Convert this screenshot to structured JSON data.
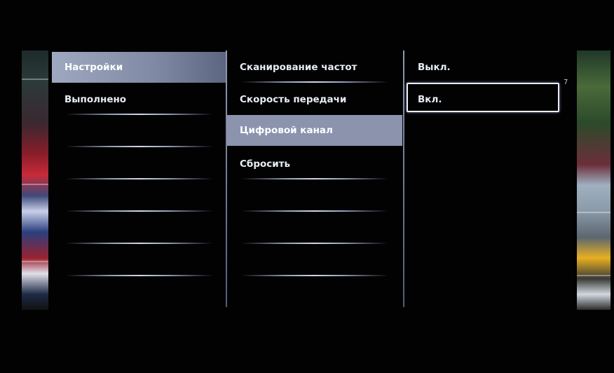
{
  "menu": {
    "column1": {
      "items": [
        "Настройки",
        "Выполнено"
      ],
      "selected_index": 0
    },
    "column2": {
      "items": [
        "Сканирование частот",
        "Скорость передачи",
        "Цифровой канал",
        "Сбросить"
      ],
      "selected_index": 2
    },
    "column3": {
      "items": [
        "Выкл.",
        "Вкл."
      ],
      "focused_index": 1
    }
  },
  "side_marker": "7"
}
